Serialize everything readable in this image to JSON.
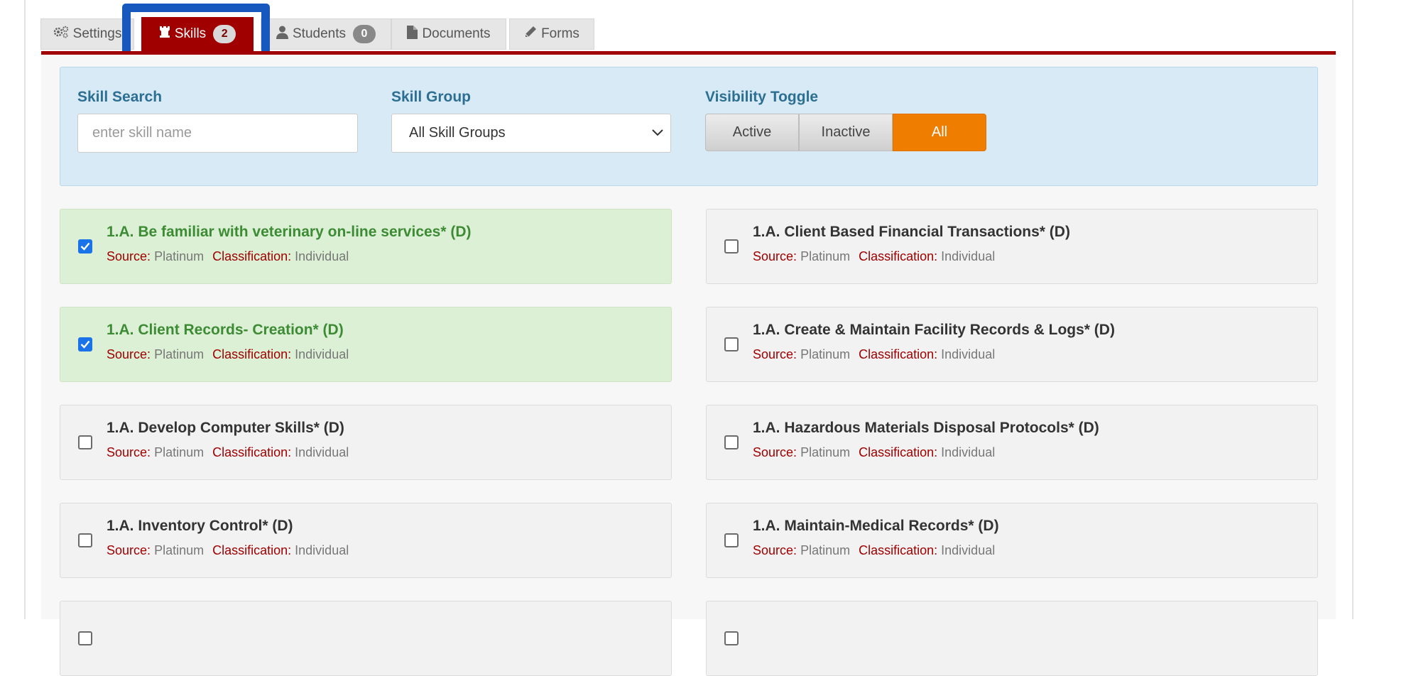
{
  "tabs": [
    {
      "label": "Settings",
      "icon": "gears-icon"
    },
    {
      "label": "Skills",
      "icon": "chess-rook-icon",
      "badge": "2",
      "active": true
    },
    {
      "label": "Students",
      "icon": "user-icon",
      "badge": "0"
    },
    {
      "label": "Documents",
      "icon": "file-icon"
    },
    {
      "label": "Forms",
      "icon": "pencil-icon"
    }
  ],
  "filters": {
    "search_label": "Skill Search",
    "search_placeholder": "enter skill name",
    "group_label": "Skill Group",
    "group_value": "All Skill Groups",
    "visibility_label": "Visibility Toggle",
    "visibility_options": [
      "Active",
      "Inactive",
      "All"
    ],
    "visibility_selected": "All"
  },
  "meta_labels": {
    "source": "Source:",
    "classification": "Classification:"
  },
  "skills": [
    {
      "title": "1.A. Be familiar with veterinary on-line services* (D)",
      "source": "Platinum",
      "classification": "Individual",
      "checked": true
    },
    {
      "title": "1.A. Client Based Financial Transactions* (D)",
      "source": "Platinum",
      "classification": "Individual",
      "checked": false
    },
    {
      "title": "1.A. Client Records- Creation* (D)",
      "source": "Platinum",
      "classification": "Individual",
      "checked": true
    },
    {
      "title": "1.A. Create & Maintain Facility Records & Logs* (D)",
      "source": "Platinum",
      "classification": "Individual",
      "checked": false
    },
    {
      "title": "1.A. Develop Computer Skills* (D)",
      "source": "Platinum",
      "classification": "Individual",
      "checked": false
    },
    {
      "title": "1.A. Hazardous Materials Disposal Protocols* (D)",
      "source": "Platinum",
      "classification": "Individual",
      "checked": false
    },
    {
      "title": "1.A. Inventory Control* (D)",
      "source": "Platinum",
      "classification": "Individual",
      "checked": false
    },
    {
      "title": "1.A. Maintain-Medical Records* (D)",
      "source": "Platinum",
      "classification": "Individual",
      "checked": false
    },
    {
      "title": "",
      "source": "",
      "classification": "",
      "checked": false
    },
    {
      "title": "",
      "source": "",
      "classification": "",
      "checked": false
    }
  ],
  "colors": {
    "accent_red": "#a00000",
    "focus_blue": "#1658bd",
    "toggle_orange": "#ef7d00",
    "checked_green": "#3d8b34"
  }
}
